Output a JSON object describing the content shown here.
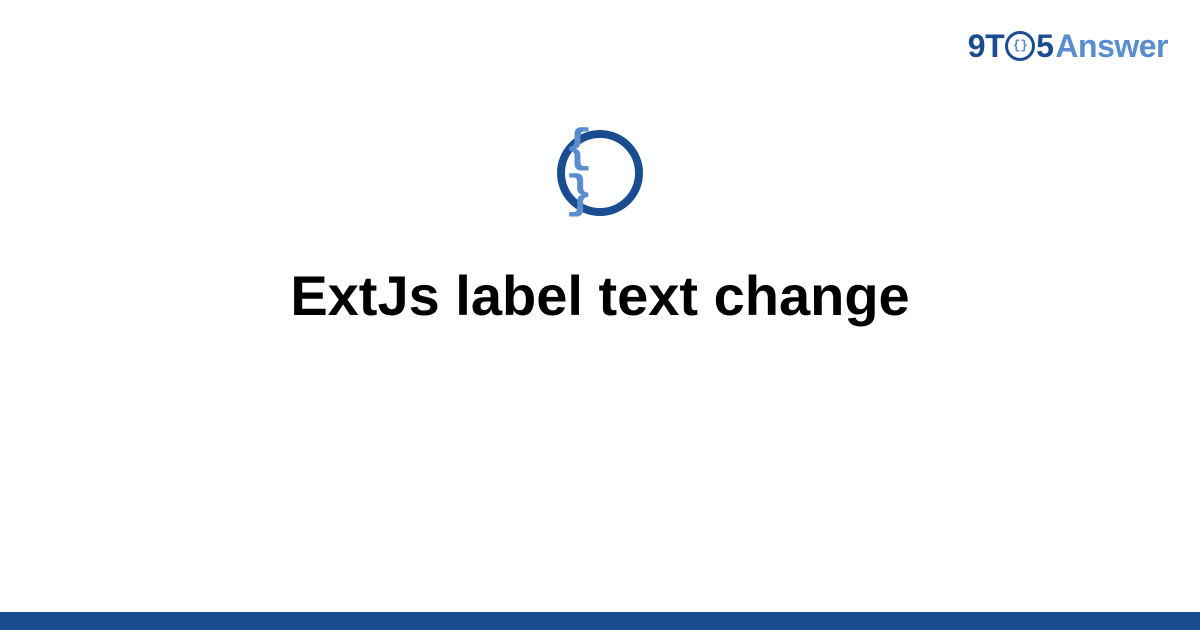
{
  "logo": {
    "part1": "9T",
    "icon_inner": "{}",
    "part2": "5",
    "part3": "Answer"
  },
  "category_icon": {
    "glyph": "{ }"
  },
  "title": "ExtJs label text change",
  "colors": {
    "primary": "#1a4d8f",
    "secondary": "#5a8dd0",
    "text": "#000000",
    "background": "#ffffff"
  }
}
